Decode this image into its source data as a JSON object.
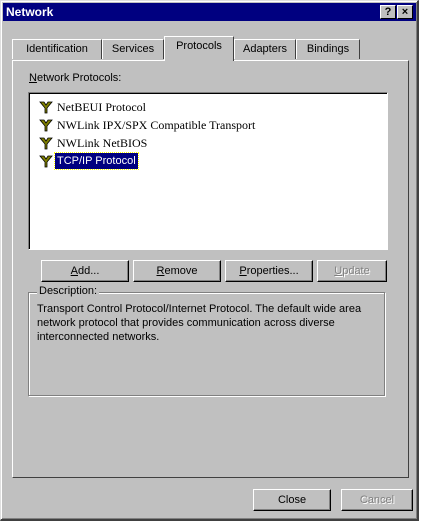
{
  "window": {
    "title": "Network",
    "help_btn": "?",
    "close_btn": "×"
  },
  "tabs": [
    "Identification",
    "Services",
    "Protocols",
    "Adapters",
    "Bindings"
  ],
  "active_tab": "Protocols",
  "list": {
    "label": "Network Protocols:",
    "items": [
      {
        "label": "NetBEUI Protocol",
        "icon": "network-protocol-icon",
        "selected": false
      },
      {
        "label": "NWLink IPX/SPX Compatible Transport",
        "icon": "network-protocol-icon",
        "selected": false
      },
      {
        "label": "NWLink NetBIOS",
        "icon": "network-protocol-icon",
        "selected": false
      },
      {
        "label": "TCP/IP Protocol",
        "icon": "network-protocol-icon",
        "selected": true
      }
    ]
  },
  "buttons": {
    "add": "Add...",
    "remove": "Remove",
    "properties": "Properties...",
    "update": "Update"
  },
  "description": {
    "label": "Description:",
    "text": "Transport Control Protocol/Internet Protocol. The default wide area network protocol that provides communication across diverse interconnected networks."
  },
  "footer": {
    "close": "Close",
    "cancel": "Cancel"
  }
}
